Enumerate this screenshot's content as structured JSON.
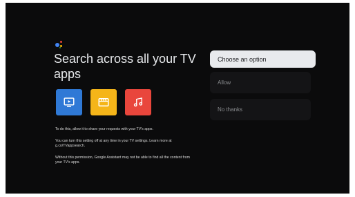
{
  "title": "Search across all your TV apps",
  "apps": [
    {
      "name": "tv-app-icon",
      "color": "#2f79d6"
    },
    {
      "name": "movies-app-icon",
      "color": "#f5b519"
    },
    {
      "name": "music-app-icon",
      "color": "#e9463c"
    }
  ],
  "text": {
    "p1": "To do this, allow it to share your requests with your TV's apps.",
    "p2": "You can turn this setting off at any time in your TV settings. Learn more at g.co/TVappsearch.",
    "p3": "Without this permission, Google Assistant may not be able to find all the content from your TV's apps."
  },
  "options": {
    "choose": "Choose an option",
    "allow": "Allow",
    "no_thanks": "No thanks"
  },
  "colors": {
    "background": "#0b0b0c",
    "selected_option": "#e8eaed",
    "unselected_option": "#141416"
  }
}
